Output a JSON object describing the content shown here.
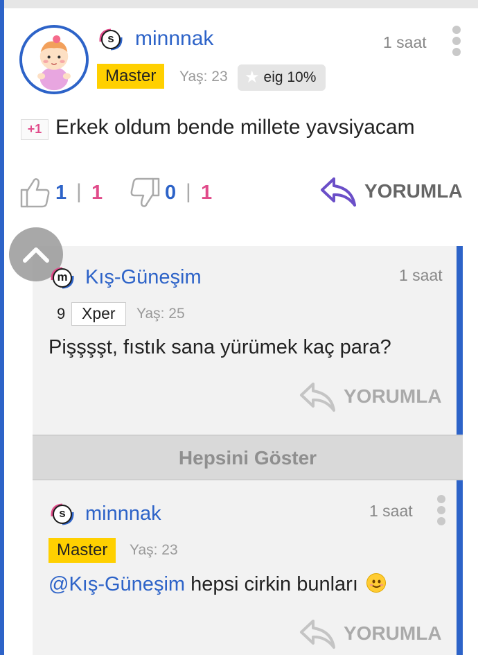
{
  "main_post": {
    "username": "minnnak",
    "gender_letter": "s",
    "time": "1 saat",
    "badge": "Master",
    "age": "Yaş: 23",
    "eig": "eig 10%",
    "plus": "+1",
    "text": "Erkek oldum bende millete yavsiyacam",
    "likes": {
      "blue": "1",
      "sep": "|",
      "pink": "1"
    },
    "dislikes": {
      "blue": "0",
      "sep": "|",
      "pink": "1"
    },
    "reply_label": "YORUMLA"
  },
  "replies": [
    {
      "username": "Kış-Güneşim",
      "gender_letter": "m",
      "time": "1 saat",
      "xper_level": "9",
      "badge": "Xper",
      "age": "Yaş: 25",
      "text": "Pişşşşt, fıstık sana yürümek kaç para?",
      "reply_label": "YORUMLA"
    },
    {
      "username": "minnnak",
      "gender_letter": "s",
      "time": "1 saat",
      "badge": "Master",
      "age": "Yaş: 23",
      "mention": "@Kış-Güneşim",
      "text": " hepsi cirkin bunları",
      "reply_label": "YORUMLA"
    }
  ],
  "show_all_label": "Hepsini Göster",
  "colors": {
    "accent_blue": "#2d63c8",
    "pink": "#e14b8a",
    "master_yellow": "#ffd000",
    "reply_purple": "#6b4fc8"
  }
}
